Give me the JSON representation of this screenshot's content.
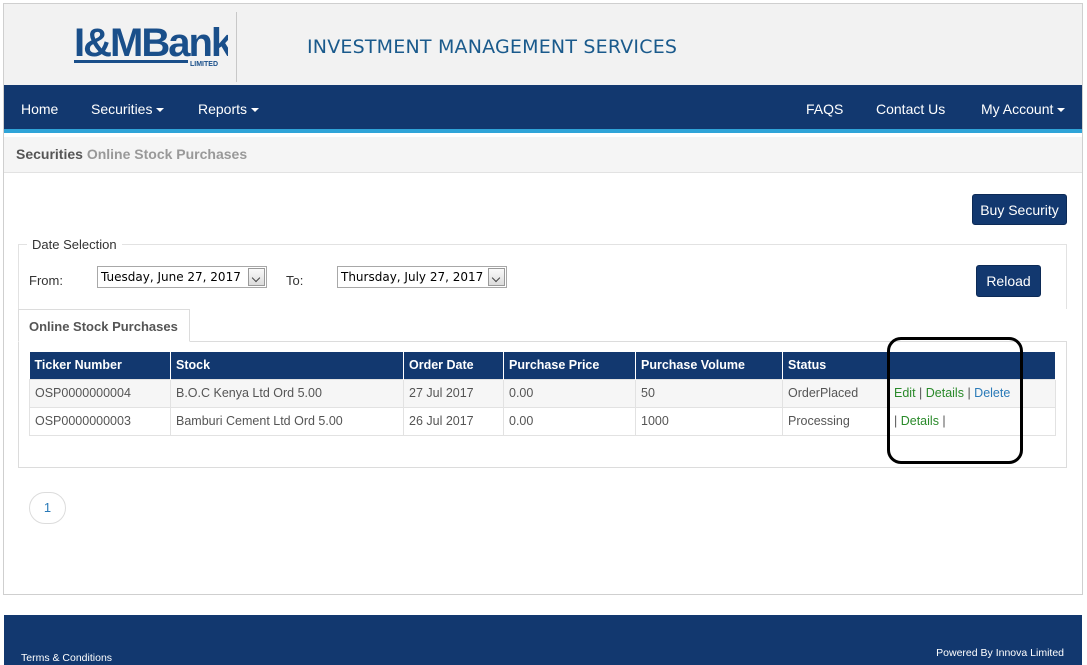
{
  "header": {
    "logo_text": "I&MBank",
    "logo_sub": "LIMITED",
    "site_title": "INVESTMENT MANAGEMENT SERVICES"
  },
  "nav": {
    "home": "Home",
    "securities": "Securities",
    "reports": "Reports",
    "faqs": "FAQS",
    "contact": "Contact Us",
    "account": "My Account"
  },
  "breadcrumb": {
    "section": "Securities",
    "page": "Online Stock Purchases"
  },
  "toolbar": {
    "buy_label": "Buy Security",
    "reload_label": "Reload"
  },
  "date_selection": {
    "legend": "Date Selection",
    "from_label": "From:",
    "from_value": "Tuesday, June 27, 2017",
    "to_label": "To:",
    "to_value": "Thursday, July 27, 2017"
  },
  "tab": {
    "label": "Online Stock Purchases"
  },
  "table": {
    "headers": [
      "Ticker Number",
      "Stock",
      "Order Date",
      "Purchase Price",
      "Purchase Volume",
      "Status",
      ""
    ],
    "rows": [
      {
        "ticker": "OSP0000000004",
        "stock": "B.O.C Kenya Ltd Ord 5.00",
        "date": "27 Jul 2017",
        "price": "0.00",
        "volume": "50",
        "status": "OrderPlaced",
        "actions": {
          "edit": "Edit",
          "sep1": " | ",
          "details": "Details",
          "sep2": " | ",
          "delete": "Delete"
        }
      },
      {
        "ticker": "OSP0000000003",
        "stock": "Bamburi Cement Ltd Ord 5.00",
        "date": "26 Jul 2017",
        "price": "0.00",
        "volume": "1000",
        "status": "Processing",
        "actions": {
          "sep1": "| ",
          "details": "Details",
          "sep2": " |"
        }
      }
    ]
  },
  "pagination": {
    "current": "1"
  },
  "footer": {
    "terms": "Terms & Conditions",
    "powered": "Powered By Innova Limited"
  },
  "colors": {
    "brand_navy": "#12386f",
    "nav_accent": "#2fa4d8",
    "action_green": "#2a8a2a",
    "action_blue": "#2a7ab8"
  }
}
